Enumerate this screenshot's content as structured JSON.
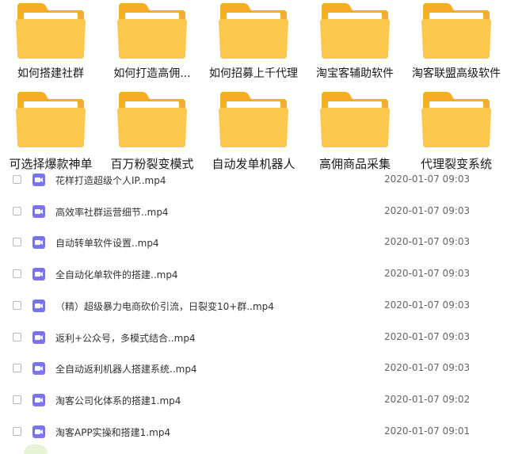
{
  "folders_row1": [
    {
      "label": "如何搭建社群"
    },
    {
      "label": "如何打造高佣..."
    },
    {
      "label": "如何招募上千代理"
    },
    {
      "label": "淘宝客辅助软件"
    },
    {
      "label": "淘客联盟高级软件"
    }
  ],
  "folders_row2": [
    {
      "label": "可选择爆款神单"
    },
    {
      "label": "百万粉裂变模式"
    },
    {
      "label": "自动发单机器人"
    },
    {
      "label": "高佣商品采集"
    },
    {
      "label": "代理裂变系统"
    }
  ],
  "files": [
    {
      "name": "花样打造超级个人IP..mp4",
      "date": "2020-01-07 09:03"
    },
    {
      "name": "高效率社群运营细节..mp4",
      "date": "2020-01-07 09:03"
    },
    {
      "name": "自动转单软件设置..mp4",
      "date": "2020-01-07 09:03"
    },
    {
      "name": "全自动化单软件的搭建..mp4",
      "date": "2020-01-07 09:03"
    },
    {
      "name": "（精）超级暴力电商砍价引流，日裂变10+群..mp4",
      "date": "2020-01-07 09:03"
    },
    {
      "name": "返利+公众号，多模式结合..mp4",
      "date": "2020-01-07 09:03"
    },
    {
      "name": "全自动返利机器人搭建系统..mp4",
      "date": "2020-01-07 09:03"
    },
    {
      "name": "淘客公司化体系的搭建1.mp4",
      "date": "2020-01-07 09:02"
    },
    {
      "name": "淘客APP实操和搭建1.mp4",
      "date": "2020-01-07 09:01"
    }
  ],
  "colors": {
    "folder_back": "#f7b733",
    "folder_front": "#fcc94e",
    "folder_paper": "#ffffff",
    "video_icon": "#7b74f2"
  },
  "icons": {
    "folder": "folder-icon",
    "video": "video-file-icon",
    "checkbox": "checkbox"
  }
}
